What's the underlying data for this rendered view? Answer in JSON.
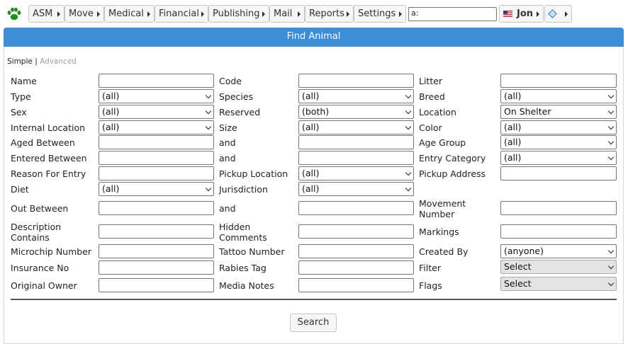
{
  "menu": {
    "items": [
      {
        "label": "ASM"
      },
      {
        "label": "Move"
      },
      {
        "label": "Medical"
      },
      {
        "label": "Financial"
      },
      {
        "label": "Publishing"
      },
      {
        "label": "Mail"
      },
      {
        "label": "Reports"
      },
      {
        "label": "Settings"
      }
    ],
    "quicksearch_value": "a:",
    "user": "Jon"
  },
  "header": {
    "title": "Find Animal"
  },
  "mode": {
    "simple": "Simple",
    "separator": "|",
    "advanced": "Advanced"
  },
  "form": {
    "name": {
      "label": "Name",
      "value": ""
    },
    "code": {
      "label": "Code",
      "value": ""
    },
    "litter": {
      "label": "Litter",
      "value": ""
    },
    "type": {
      "label": "Type",
      "value": "(all)"
    },
    "species": {
      "label": "Species",
      "value": "(all)"
    },
    "breed": {
      "label": "Breed",
      "value": "(all)"
    },
    "sex": {
      "label": "Sex",
      "value": "(all)"
    },
    "reserved": {
      "label": "Reserved",
      "value": "(both)"
    },
    "location": {
      "label": "Location",
      "value": "On Shelter"
    },
    "internal_location": {
      "label": "Internal Location",
      "value": "(all)"
    },
    "size": {
      "label": "Size",
      "value": "(all)"
    },
    "color": {
      "label": "Color",
      "value": "(all)"
    },
    "aged_between": {
      "label": "Aged Between",
      "from": "",
      "and_label": "and",
      "to": ""
    },
    "age_group": {
      "label": "Age Group",
      "value": "(all)"
    },
    "entered_between": {
      "label": "Entered Between",
      "from": "",
      "and_label": "and",
      "to": ""
    },
    "entry_category": {
      "label": "Entry Category",
      "value": "(all)"
    },
    "reason_for_entry": {
      "label": "Reason For Entry",
      "value": ""
    },
    "pickup_location": {
      "label": "Pickup Location",
      "value": "(all)"
    },
    "pickup_address": {
      "label": "Pickup Address",
      "value": ""
    },
    "diet": {
      "label": "Diet",
      "value": "(all)"
    },
    "jurisdiction": {
      "label": "Jurisdiction",
      "value": "(all)"
    },
    "out_between": {
      "label": "Out Between",
      "from": "",
      "and_label": "and",
      "to": ""
    },
    "movement_number": {
      "label_line1": "Movement",
      "label_line2": "Number",
      "value": ""
    },
    "description_contains": {
      "label_line1": "Description",
      "label_line2": "Contains",
      "value": ""
    },
    "hidden_comments": {
      "label_line1": "Hidden",
      "label_line2": "Comments",
      "value": ""
    },
    "markings": {
      "label": "Markings",
      "value": ""
    },
    "microchip_number": {
      "label": "Microchip Number",
      "value": ""
    },
    "tattoo_number": {
      "label": "Tattoo Number",
      "value": ""
    },
    "created_by": {
      "label": "Created By",
      "value": "(anyone)"
    },
    "insurance_no": {
      "label": "Insurance No",
      "value": ""
    },
    "rabies_tag": {
      "label": "Rabies Tag",
      "value": ""
    },
    "filter": {
      "label": "Filter",
      "value": "Select"
    },
    "original_owner": {
      "label": "Original Owner",
      "value": ""
    },
    "media_notes": {
      "label": "Media Notes",
      "value": ""
    },
    "flags": {
      "label": "Flags",
      "value": "Select"
    }
  },
  "actions": {
    "search_label": "Search"
  },
  "colors": {
    "header_bg": "#3c8dd8",
    "logo_green": "#1f8f1f"
  }
}
